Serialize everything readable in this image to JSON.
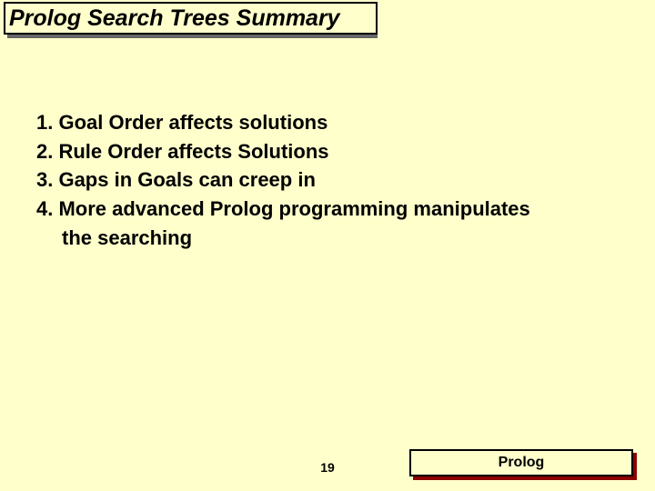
{
  "title": "Prolog Search Trees Summary",
  "items": {
    "i1": "1. Goal Order affects solutions",
    "i2": "2. Rule Order affects Solutions",
    "i3": "3. Gaps in Goals can creep in",
    "i4a": "4. More advanced Prolog programming manipulates",
    "i4b": "the searching"
  },
  "page_number": "19",
  "footer_label": "Prolog"
}
